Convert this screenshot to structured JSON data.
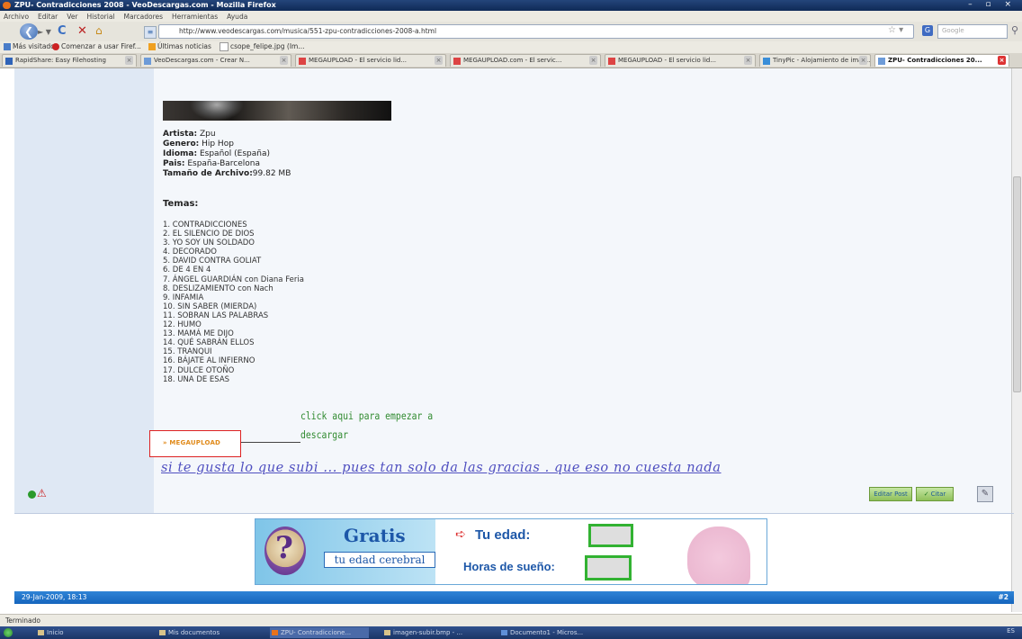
{
  "window": {
    "title": "ZPU- Contradicciones 2008 - VeoDescargas.com - Mozilla Firefox",
    "controls": "– ▫ ×"
  },
  "menu": [
    "Archivo",
    "Editar",
    "Ver",
    "Historial",
    "Marcadores",
    "Herramientas",
    "Ayuda"
  ],
  "nav": {
    "url": "http://www.veodescargas.com/musica/551-zpu-contradicciones-2008-a.html",
    "search_placeholder": "Google",
    "back_icon": "back-arrow-icon",
    "reload_icon": "reload-icon",
    "stop_icon": "stop-icon",
    "home_icon": "home-icon"
  },
  "bookmarks": [
    "Más visitados",
    "Comenzar a usar Firef...",
    "Últimas noticias",
    "csope_felipe.jpg (Im..."
  ],
  "tabs": [
    "RapidShare: Easy Filehosting",
    "VeoDescargas.com - Crear N...",
    "MEGAUPLOAD - El servicio lid...",
    "MEGAUPLOAD.com - El servic...",
    "MEGAUPLOAD - El servicio lid...",
    "TinyPic - Alojamiento de imág...",
    "ZPU- Contradicciones 20..."
  ],
  "post": {
    "info": [
      {
        "label": "Artista:",
        "value": " Zpu"
      },
      {
        "label": "Genero:",
        "value": " Hip Hop"
      },
      {
        "label": "Idioma:",
        "value": " Español (España)"
      },
      {
        "label": "Pais:",
        "value": " España-Barcelona"
      },
      {
        "label": "Tamaño de Archivo:",
        "value": "99.82 MB"
      }
    ],
    "temas_label": "Temas:",
    "tracks": [
      "1. CONTRADICCIONES",
      "2. EL SILENCIO DE DIOS",
      "3. YO SOY UN SOLDADO",
      "4. DECORADO",
      "5. DAVID CONTRA GOLIAT",
      "6. DE 4 EN 4",
      "7. ÁNGEL GUARDIÁN con Diana Feria",
      "8. DESLIZAMIENTO con Nach",
      "9. INFAMIA",
      "10. SIN SABER (MIERDA)",
      "11. SOBRAN LAS PALABRAS",
      "12. HUMO",
      "13. MAMÁ ME DIJO",
      "14. QUÉ SABRÁN ELLOS",
      "15. TRANQUI",
      "16. BÁJATE AL INFIERNO",
      "17. DULCE OTOÑO",
      "18. UNA DE ESAS"
    ],
    "download_button": "» MEGAUPLOAD",
    "callout_line1": "click aqui para empezar a",
    "callout_line2": "descargar",
    "signature": "si te gusta lo que subi ... pues tan solo da las gracias . que eso no cuesta nada",
    "edit_label": "Editar Post",
    "quote_label": "Citar"
  },
  "ad": {
    "gratis": "Gratis",
    "subtitle": "tu edad cerebral",
    "tu_edad": "Tu edad:",
    "horas": "Horas de sueño:"
  },
  "footer": {
    "date": "29-Jan-2009, 18:13",
    "post_number": "#2"
  },
  "status": "Terminado",
  "taskbar": {
    "items": [
      "Inicio",
      "Mis documentos",
      "ZPU- Contradiccione...",
      "imagen-subir.bmp - ...",
      "Documento1 - Micros..."
    ],
    "clock": "ES"
  }
}
